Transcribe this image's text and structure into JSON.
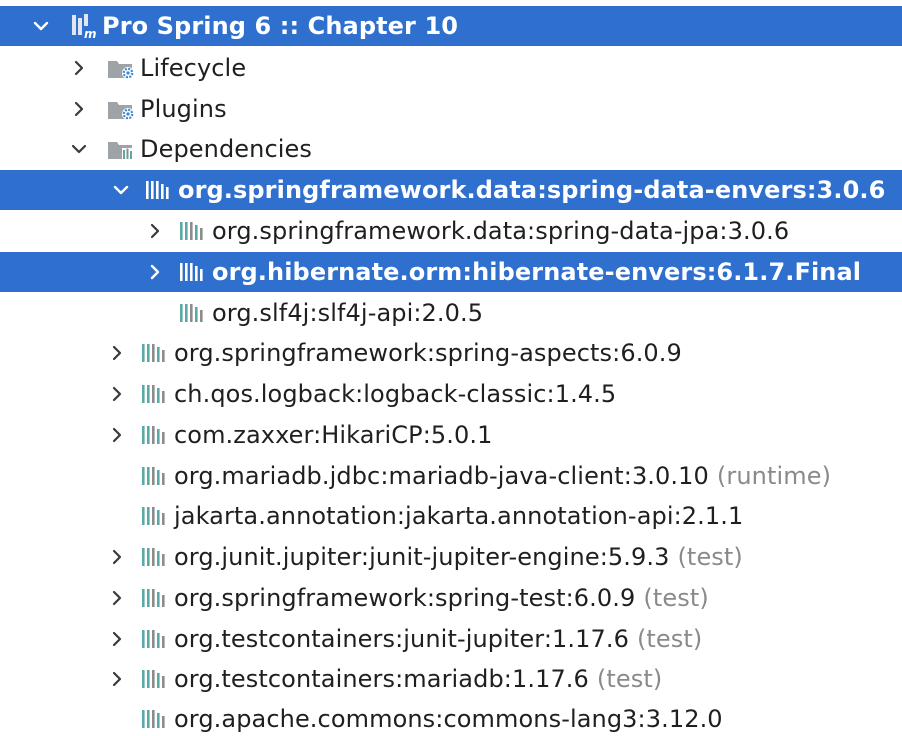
{
  "colors": {
    "selection": "#2f6fce",
    "library_bar_teal": "#5aa9a6",
    "library_bar_gray": "#8c8c8c",
    "folder_gray": "#9ea3a8",
    "gear_blue": "#3a86d6",
    "scope_gray": "#8a8a8a"
  },
  "tree": {
    "project": {
      "label": "Pro Spring 6 :: Chapter 10",
      "icon": "maven-project-icon",
      "expanded": true,
      "selected": true
    },
    "lifecycle": {
      "label": "Lifecycle",
      "icon": "lifecycle-folder-icon",
      "expanded": false
    },
    "plugins": {
      "label": "Plugins",
      "icon": "plugins-folder-icon",
      "expanded": false
    },
    "dependencies": {
      "label": "Dependencies",
      "icon": "dependencies-folder-icon",
      "expanded": true
    },
    "items": [
      {
        "label": "org.springframework.data:spring-data-envers:3.0.6",
        "scope": "",
        "expander": "expanded",
        "selected": true,
        "icon": "library-icon"
      },
      {
        "label": "org.springframework.data:spring-data-jpa:3.0.6",
        "scope": "",
        "expander": "collapsed",
        "selected": false,
        "icon": "library-icon"
      },
      {
        "label": "org.hibernate.orm:hibernate-envers:6.1.7.Final",
        "scope": "",
        "expander": "collapsed",
        "selected": true,
        "icon": "library-icon"
      },
      {
        "label": "org.slf4j:slf4j-api:2.0.5",
        "scope": "",
        "expander": "none",
        "selected": false,
        "icon": "library-icon"
      },
      {
        "label": "org.springframework:spring-aspects:6.0.9",
        "scope": "",
        "expander": "collapsed",
        "selected": false,
        "icon": "library-icon"
      },
      {
        "label": "ch.qos.logback:logback-classic:1.4.5",
        "scope": "",
        "expander": "collapsed",
        "selected": false,
        "icon": "library-icon"
      },
      {
        "label": "com.zaxxer:HikariCP:5.0.1",
        "scope": "",
        "expander": "collapsed",
        "selected": false,
        "icon": "library-icon"
      },
      {
        "label": "org.mariadb.jdbc:mariadb-java-client:3.0.10",
        "scope": "(runtime)",
        "expander": "none",
        "selected": false,
        "icon": "library-icon"
      },
      {
        "label": "jakarta.annotation:jakarta.annotation-api:2.1.1",
        "scope": "",
        "expander": "none",
        "selected": false,
        "icon": "library-icon"
      },
      {
        "label": "org.junit.jupiter:junit-jupiter-engine:5.9.3",
        "scope": "(test)",
        "expander": "collapsed",
        "selected": false,
        "icon": "library-icon"
      },
      {
        "label": "org.springframework:spring-test:6.0.9",
        "scope": "(test)",
        "expander": "collapsed",
        "selected": false,
        "icon": "library-icon"
      },
      {
        "label": "org.testcontainers:junit-jupiter:1.17.6",
        "scope": "(test)",
        "expander": "collapsed",
        "selected": false,
        "icon": "library-icon"
      },
      {
        "label": "org.testcontainers:mariadb:1.17.6",
        "scope": "(test)",
        "expander": "collapsed",
        "selected": false,
        "icon": "library-icon"
      },
      {
        "label": "org.apache.commons:commons-lang3:3.12.0",
        "scope": "",
        "expander": "none",
        "selected": false,
        "icon": "library-icon"
      }
    ]
  }
}
